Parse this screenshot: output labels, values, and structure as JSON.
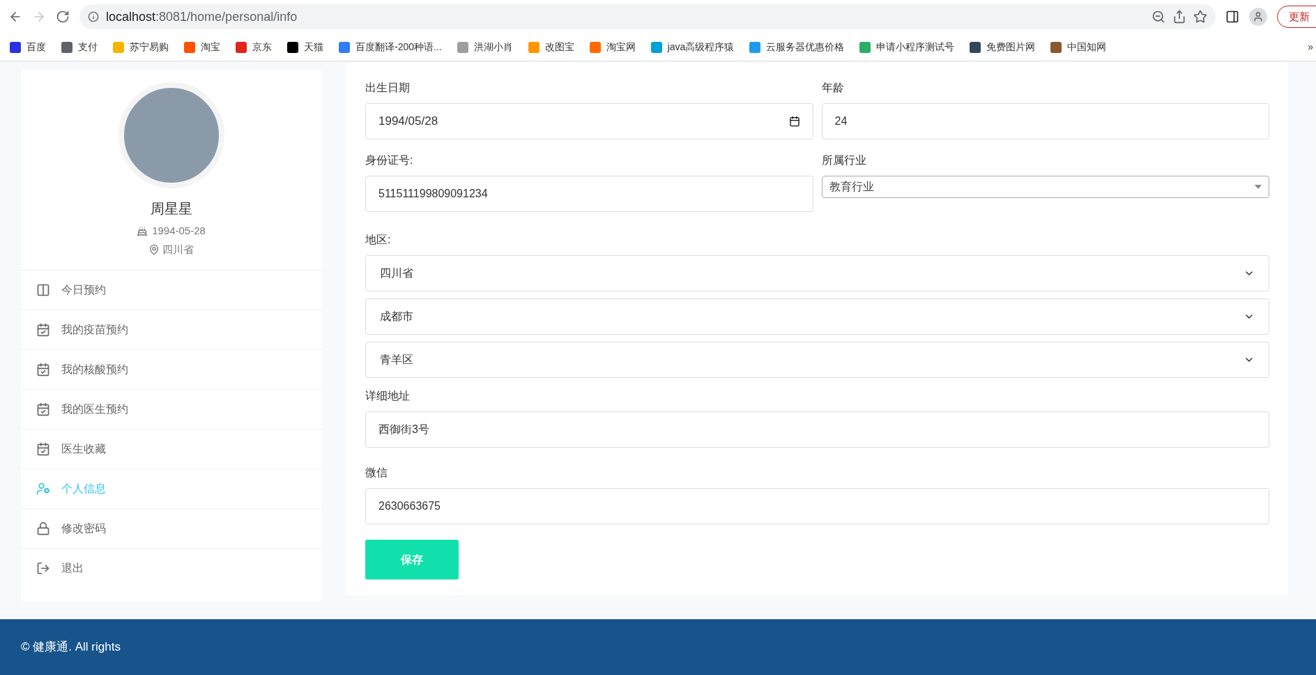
{
  "browser": {
    "url_host": "localhost",
    "url_path": ":8081/home/personal/info",
    "forward_disabled": true,
    "update_button": "更新",
    "bookmarks": [
      {
        "label": "百度",
        "color": "#2932e1"
      },
      {
        "label": "支付",
        "color": "#5f6368"
      },
      {
        "label": "苏宁易购",
        "color": "#f7b500"
      },
      {
        "label": "淘宝",
        "color": "#ff5000"
      },
      {
        "label": "京东",
        "color": "#e1251b"
      },
      {
        "label": "天猫",
        "color": "#000000"
      },
      {
        "label": "百度翻译-200种语...",
        "color": "#2f7cf6"
      },
      {
        "label": "洪湖小肖",
        "color": "#9e9e9e"
      },
      {
        "label": "改图宝",
        "color": "#ff9800"
      },
      {
        "label": "淘宝网",
        "color": "#ff6a00"
      },
      {
        "label": "java高级程序猿",
        "color": "#00a1d6"
      },
      {
        "label": "云服务器优惠价格",
        "color": "#1e9bf0"
      },
      {
        "label": "申请小程序测试号",
        "color": "#2aae67"
      },
      {
        "label": "免费图片网",
        "color": "#35465c"
      },
      {
        "label": "中国知网",
        "color": "#8b5a2b"
      }
    ],
    "more": "»"
  },
  "profile": {
    "name": "周星星",
    "birthday": "1994-05-28",
    "location": "四川省"
  },
  "menu": [
    {
      "label": "今日预约",
      "kind": "columns",
      "selected": false
    },
    {
      "label": "我的疫苗预约",
      "kind": "calendar",
      "selected": false
    },
    {
      "label": "我的核酸预约",
      "kind": "calendar",
      "selected": false
    },
    {
      "label": "我的医生预约",
      "kind": "calendar",
      "selected": false
    },
    {
      "label": "医生收藏",
      "kind": "calendar",
      "selected": false
    },
    {
      "label": "个人信息",
      "kind": "user",
      "selected": true
    },
    {
      "label": "修改密码",
      "kind": "lock",
      "selected": false
    },
    {
      "label": "退出",
      "kind": "exit",
      "selected": false
    }
  ],
  "form": {
    "birth_label": "出生日期",
    "birth_value": "1994/05/28",
    "age_label": "年龄",
    "age_value": "24",
    "id_label": "身份证号:",
    "id_value": "511511199809091234",
    "industry_label": "所属行业",
    "industry_value": "教育行业",
    "region_label": "地区:",
    "regions": [
      "四川省",
      "成都市",
      "青羊区"
    ],
    "address_label": "详细地址",
    "address_value": "西御街3号",
    "wechat_label": "微信",
    "wechat_value": "2630663675",
    "save": "保存"
  },
  "footer": {
    "text": "© 健康通. All rights"
  }
}
